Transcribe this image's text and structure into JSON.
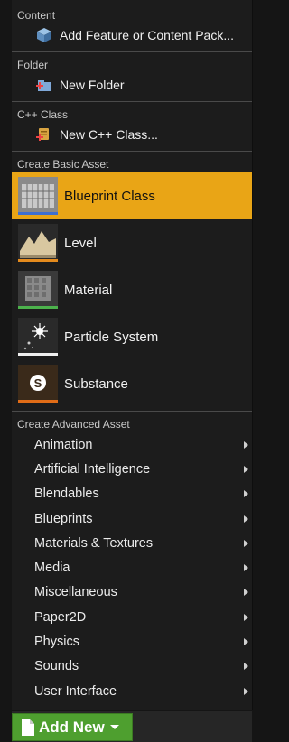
{
  "colors": {
    "accent_highlight": "#e9a516",
    "add_new_green": "#4e9f2f",
    "blueprint_bar": "#3d6fd1",
    "level_bar": "#e38a1d",
    "material_bar": "#4cb24c",
    "particle_bar": "#f0f0f0",
    "substance_bar": "#e06c17"
  },
  "sections": {
    "content": {
      "header": "Content",
      "items": [
        {
          "label": "Add Feature or Content Pack...",
          "icon": "cube-package-icon"
        }
      ]
    },
    "folder": {
      "header": "Folder",
      "items": [
        {
          "label": "New Folder",
          "icon": "new-folder-icon"
        }
      ]
    },
    "cpp": {
      "header": "C++ Class",
      "items": [
        {
          "label": "New C++ Class...",
          "icon": "cpp-class-icon"
        }
      ]
    },
    "basic": {
      "header": "Create Basic Asset",
      "items": [
        {
          "label": "Blueprint Class",
          "icon": "blueprint-icon"
        },
        {
          "label": "Level",
          "icon": "level-icon"
        },
        {
          "label": "Material",
          "icon": "material-icon"
        },
        {
          "label": "Particle System",
          "icon": "particle-system-icon"
        },
        {
          "label": "Substance",
          "icon": "substance-icon"
        }
      ]
    },
    "advanced": {
      "header": "Create Advanced Asset",
      "items": [
        {
          "label": "Animation"
        },
        {
          "label": "Artificial Intelligence"
        },
        {
          "label": "Blendables"
        },
        {
          "label": "Blueprints"
        },
        {
          "label": "Materials & Textures"
        },
        {
          "label": "Media"
        },
        {
          "label": "Miscellaneous"
        },
        {
          "label": "Paper2D"
        },
        {
          "label": "Physics"
        },
        {
          "label": "Sounds"
        },
        {
          "label": "User Interface"
        }
      ]
    }
  },
  "add_new": {
    "label": "Add New"
  }
}
